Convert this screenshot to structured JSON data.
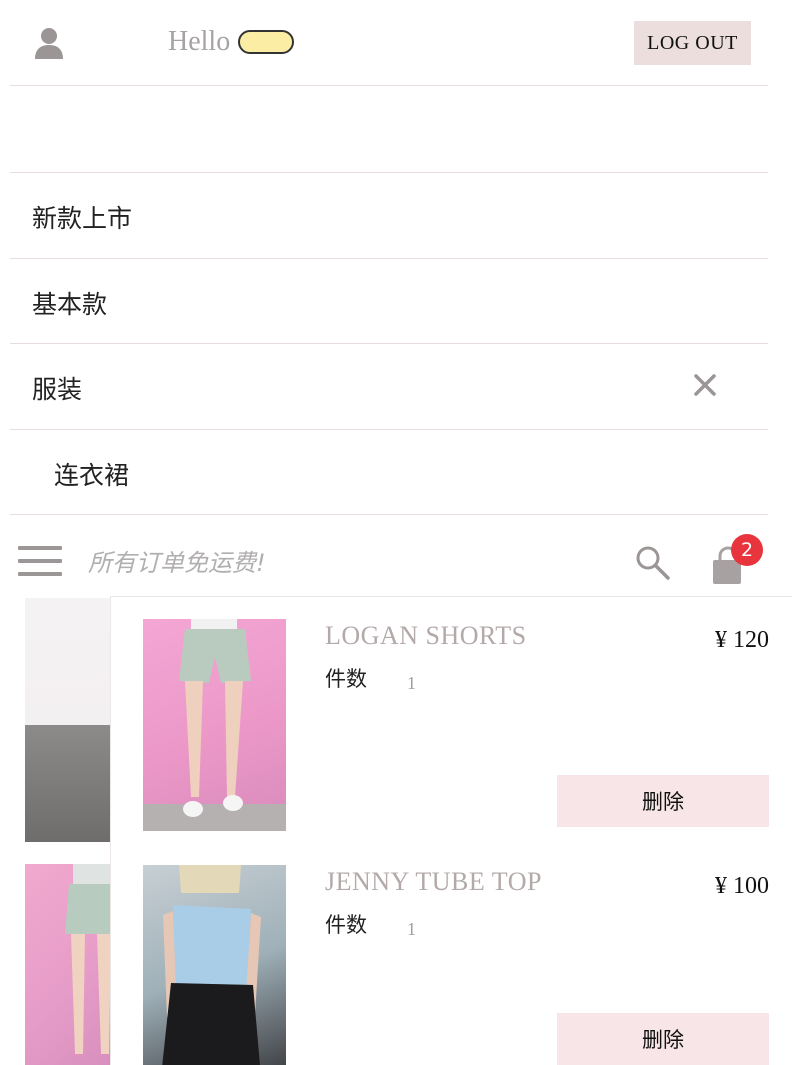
{
  "header": {
    "greeting": "Hello",
    "logout_label": "LOG OUT"
  },
  "menu": {
    "items": [
      {
        "label": "新款上市"
      },
      {
        "label": "基本款"
      },
      {
        "label": "服装"
      },
      {
        "label": "连衣裙"
      }
    ]
  },
  "promo": {
    "text": "所有订单免运费!",
    "cart_count": "2"
  },
  "cart": {
    "items": [
      {
        "name": "LOGAN SHORTS",
        "price": "¥ 120",
        "qty_label": "件数",
        "qty": "1",
        "delete_label": "删除"
      },
      {
        "name": "JENNY TUBE TOP",
        "price": "¥ 100",
        "qty_label": "件数",
        "qty": "1",
        "delete_label": "删除"
      }
    ]
  },
  "colors": {
    "accent_pink": "#f7e5e7",
    "badge_red": "#e8343c",
    "muted_text": "#b3a9a9"
  }
}
